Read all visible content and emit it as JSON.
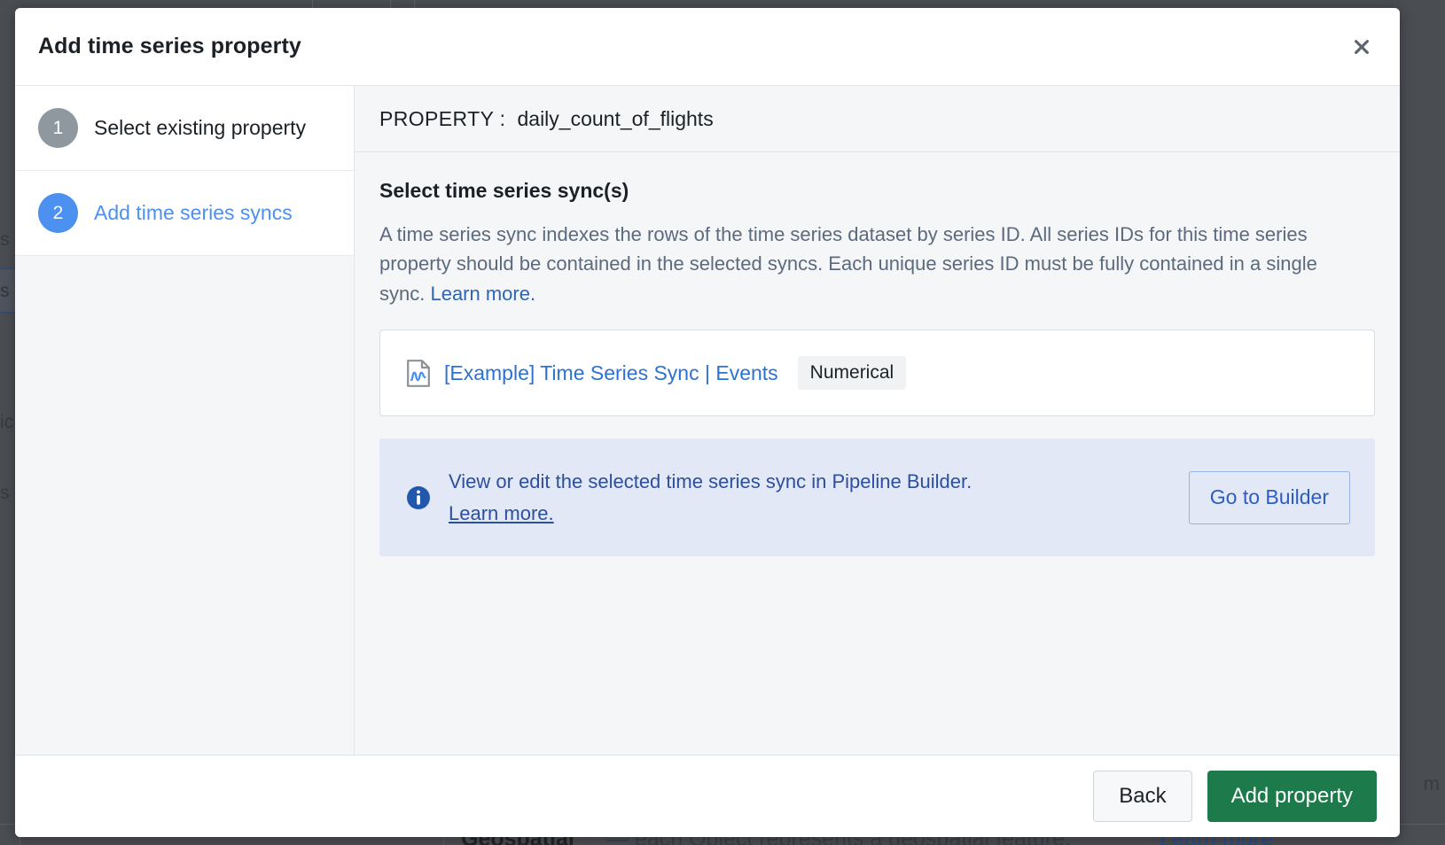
{
  "modal": {
    "title": "Add time series property",
    "close_icon": "close-icon"
  },
  "steps": [
    {
      "number": "1",
      "label": "Select existing property",
      "state": "inactive"
    },
    {
      "number": "2",
      "label": "Add time series syncs",
      "state": "active"
    }
  ],
  "property_bar": {
    "label": "PROPERTY :",
    "value": "daily_count_of_flights"
  },
  "section": {
    "heading": "Select time series sync(s)",
    "description": "A time series sync indexes the rows of the time series dataset by series ID. All series IDs for this time series property should be contained in the selected syncs. Each unique series ID must be fully contained in a single sync. ",
    "link": "Learn more."
  },
  "sync_card": {
    "icon": "time-series-file-icon",
    "name": "[Example] Time Series Sync | Events",
    "badge": "Numerical"
  },
  "callout": {
    "icon": "info-icon",
    "text": "View or edit the selected time series sync in Pipeline Builder.",
    "link": "Learn more.",
    "button_label": "Go to Builder"
  },
  "footer": {
    "back_label": "Back",
    "submit_label": "Add property"
  },
  "background": {
    "bottom_bold": "Geospatial",
    "bottom_regular": "— each Object represents a geospatial feature.",
    "bottom_link": "Learn more",
    "left_fragment_1": "s",
    "left_fragment_2": "s",
    "left_fragment_3": "ic",
    "left_fragment_4": "s",
    "right_fragment": "m"
  },
  "colors": {
    "accent_blue": "#4c90f0",
    "link_blue": "#2d72d2",
    "callout_bg": "#e2e8f6",
    "submit_green": "#1c7a4b",
    "step_gray": "#8f979f"
  }
}
